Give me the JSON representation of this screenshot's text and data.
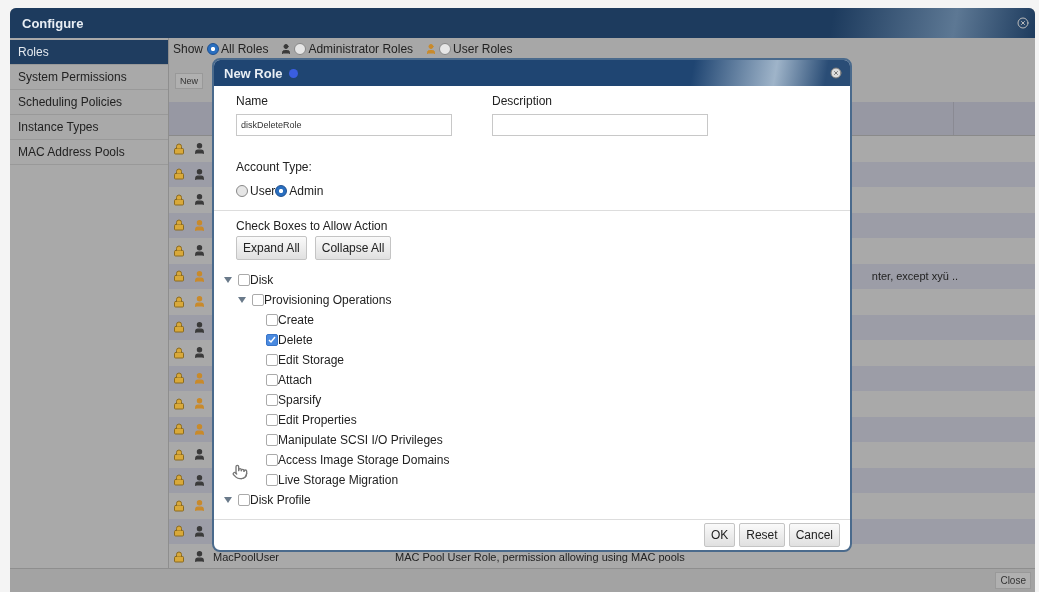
{
  "window": {
    "title": "Configure"
  },
  "sidebar": {
    "items": [
      {
        "label": "Roles",
        "selected": true
      },
      {
        "label": "System Permissions",
        "selected": false
      },
      {
        "label": "Scheduling Policies",
        "selected": false
      },
      {
        "label": "Instance Types",
        "selected": false
      },
      {
        "label": "MAC Address Pools",
        "selected": false
      }
    ]
  },
  "filter": {
    "label": "Show",
    "options": [
      {
        "label": "All Roles",
        "selected": true,
        "kind": "all"
      },
      {
        "label": "Administrator Roles",
        "selected": false,
        "kind": "admin"
      },
      {
        "label": "User Roles",
        "selected": false,
        "kind": "user"
      }
    ]
  },
  "toolbar": {
    "buttons": [
      "New"
    ]
  },
  "table": {
    "rows": [
      {
        "kind": "admin"
      },
      {
        "kind": "admin"
      },
      {
        "kind": "admin"
      },
      {
        "kind": "user"
      },
      {
        "kind": "admin"
      },
      {
        "kind": "user",
        "description": "nter, except xyü ..",
        "description_cut": true
      },
      {
        "kind": "user"
      },
      {
        "kind": "admin"
      },
      {
        "kind": "admin"
      },
      {
        "kind": "user"
      },
      {
        "kind": "user"
      },
      {
        "kind": "user"
      },
      {
        "kind": "admin"
      },
      {
        "kind": "admin"
      },
      {
        "kind": "user"
      },
      {
        "kind": "admin"
      },
      {
        "kind": "admin",
        "name": "MacPoolUser",
        "description": "MAC Pool User Role, permission allowing using MAC pools"
      }
    ]
  },
  "dialog": {
    "title": "New Role",
    "name_label": "Name",
    "name_value": "diskDeleteRole",
    "description_label": "Description",
    "account_type_label": "Account Type:",
    "account_types": [
      {
        "label": "User",
        "selected": false
      },
      {
        "label": "Admin",
        "selected": true
      }
    ],
    "actions_label": "Check Boxes to Allow Action",
    "tree_buttons": [
      "Expand All",
      "Collapse All"
    ],
    "tree": [
      {
        "label": "Disk",
        "checked": false,
        "expanded": true,
        "children": [
          {
            "label": "Provisioning Operations",
            "checked": false,
            "expanded": true,
            "children": [
              {
                "label": "Create",
                "checked": false
              },
              {
                "label": "Delete",
                "checked": true
              },
              {
                "label": "Edit Storage",
                "checked": false
              },
              {
                "label": "Attach",
                "checked": false
              },
              {
                "label": "Sparsify",
                "checked": false
              },
              {
                "label": "Edit Properties",
                "checked": false
              },
              {
                "label": "Manipulate SCSI I/O Privileges",
                "checked": false
              },
              {
                "label": "Access Image Storage Domains",
                "checked": false
              },
              {
                "label": "Live Storage Migration",
                "checked": false
              }
            ]
          }
        ]
      },
      {
        "label": "Disk Profile",
        "checked": false,
        "expanded": true
      }
    ],
    "buttons": [
      "OK",
      "Reset",
      "Cancel"
    ]
  },
  "footer": {
    "buttons": [
      "Close"
    ]
  }
}
